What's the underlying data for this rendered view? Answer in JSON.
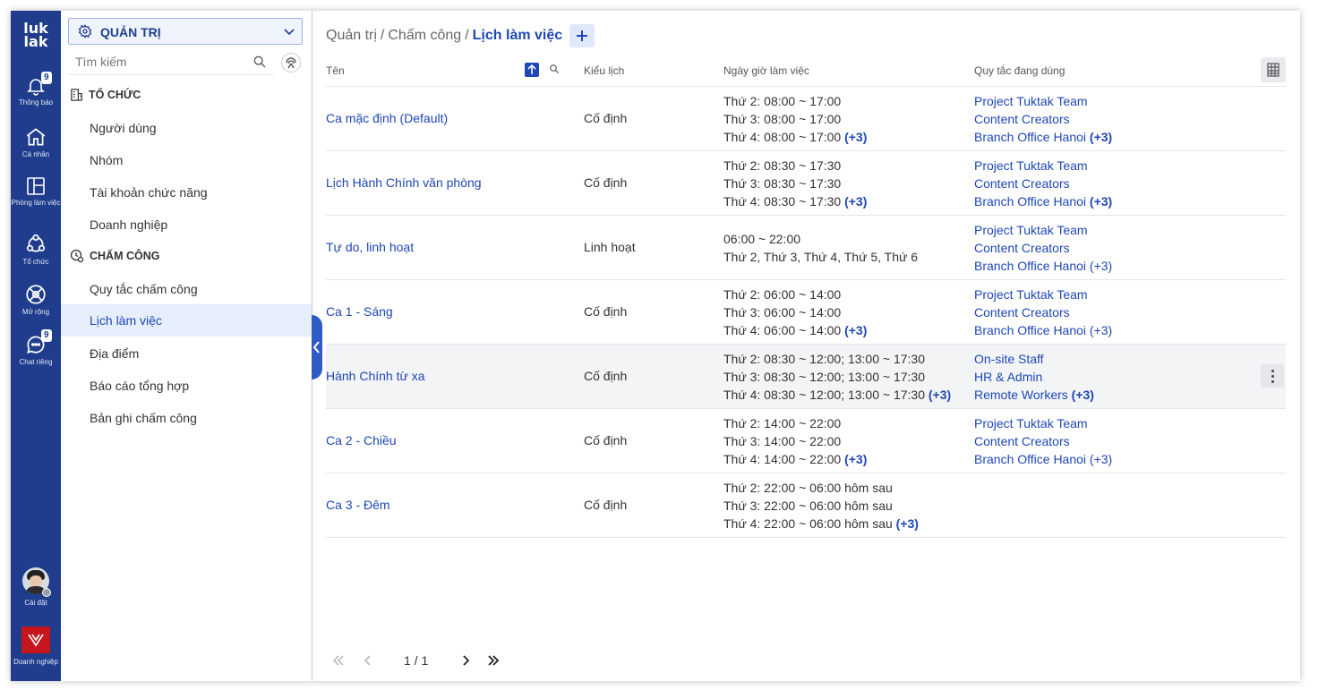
{
  "rail": {
    "logo_line1": "luk",
    "logo_line2": "lak",
    "items": [
      {
        "label": "Thông báo",
        "icon": "bell-icon",
        "badge": "9"
      },
      {
        "label": "Cá nhân",
        "icon": "home-icon"
      },
      {
        "label": "Phòng làm việc",
        "icon": "workspace-icon"
      },
      {
        "label": "Tổ chức",
        "icon": "organization-icon"
      },
      {
        "label": "Mở rộng",
        "icon": "extension-icon"
      },
      {
        "label": "Chat riêng",
        "icon": "chat-icon",
        "badge": "9"
      }
    ],
    "settings_label": "Cài đặt",
    "corp_label": "Doanh nghiệp"
  },
  "sidebar": {
    "dropdown_label": "QUẢN TRỊ",
    "search_placeholder": "Tìm kiếm",
    "section_org": "TỔ CHỨC",
    "org_items": [
      "Người dùng",
      "Nhóm",
      "Tài khoản chức năng",
      "Doanh nghiệp"
    ],
    "section_att": "CHẤM CÔNG",
    "att_items": [
      "Quy tắc chấm công",
      "Lịch làm việc",
      "Địa điểm",
      "Báo cáo tổng hợp",
      "Bản ghi chấm công"
    ],
    "active_item": "Lịch làm việc"
  },
  "breadcrumb": {
    "part1": "Quản trị",
    "part2": "Chấm công",
    "current": "Lịch làm việc",
    "separator": "/"
  },
  "table": {
    "headers": {
      "name": "Tên",
      "type": "Kiểu lịch",
      "time": "Ngày giờ làm việc",
      "rules": "Quy tắc đang dùng"
    },
    "rows": [
      {
        "name": "Ca mặc định (Default)",
        "type": "Cố định",
        "times": [
          "Thứ 2: 08:00 ~ 17:00",
          "Thứ 3: 08:00 ~ 17:00",
          "Thứ 4: 08:00 ~ 17:00"
        ],
        "times_more": "(+3)",
        "rules": [
          "Project Tuktak Team",
          "Content Creators",
          "Branch Office Hanoi"
        ],
        "rules_more": "(+3)"
      },
      {
        "name": "Lịch Hành Chính văn phòng",
        "type": "Cố định",
        "times": [
          "Thứ 2: 08:30 ~ 17:30",
          "Thứ 3: 08:30 ~ 17:30",
          "Thứ 4: 08:30 ~ 17:30"
        ],
        "times_more": "(+3)",
        "rules": [
          "Project Tuktak Team",
          "Content Creators",
          "Branch Office Hanoi"
        ],
        "rules_more": "(+3)"
      },
      {
        "name": "Tự do, linh hoạt",
        "type": "Linh hoạt",
        "times": [
          "06:00 ~ 22:00",
          "Thứ 2, Thứ 3, Thứ 4, Thứ 5, Thứ 6"
        ],
        "times_more": "",
        "rules": [
          "Project Tuktak Team",
          "Content Creators",
          "Branch Office Hanoi"
        ],
        "rules_more": "(+3)"
      },
      {
        "name": "Ca 1 - Sáng",
        "type": "Cố định",
        "times": [
          "Thứ 2: 06:00 ~ 14:00",
          "Thứ 3: 06:00 ~ 14:00",
          "Thứ 4: 06:00 ~ 14:00"
        ],
        "times_more": "(+3)",
        "rules": [
          "Project Tuktak Team",
          "Content Creators",
          "Branch Office Hanoi"
        ],
        "rules_more": "(+3)"
      },
      {
        "name": "Hành Chính từ xa",
        "type": "Cố định",
        "times": [
          "Thứ 2: 08:30 ~ 12:00; 13:00 ~ 17:30",
          "Thứ 3: 08:30 ~ 12:00; 13:00 ~ 17:30",
          "Thứ 4: 08:30 ~ 12:00; 13:00 ~ 17:30"
        ],
        "times_more": "(+3)",
        "rules": [
          "On-site Staff",
          "HR & Admin",
          "Remote Workers"
        ],
        "rules_more": "(+3)"
      },
      {
        "name": "Ca 2 - Chiều",
        "type": "Cố định",
        "times": [
          "Thứ 2: 14:00 ~ 22:00",
          "Thứ 3: 14:00 ~ 22:00",
          "Thứ 4: 14:00 ~ 22:00"
        ],
        "times_more": "(+3)",
        "rules": [
          "Project Tuktak Team",
          "Content Creators",
          "Branch Office Hanoi"
        ],
        "rules_more": "(+3)"
      },
      {
        "name": "Ca 3 - Đêm",
        "type": "Cố định",
        "times": [
          "Thứ 2: 22:00 ~ 06:00 hôm sau",
          "Thứ 3: 22:00 ~ 06:00 hôm sau",
          "Thứ 4: 22:00 ~ 06:00 hôm sau"
        ],
        "times_more": "(+3)",
        "rules": [],
        "rules_more": ""
      }
    ]
  },
  "pager": {
    "text": "1 / 1"
  },
  "colors": {
    "rail": "#1f3d8c",
    "accent": "#1f47b6",
    "active_bg": "#e6eefb",
    "row_hover": "#f3f4f6"
  }
}
